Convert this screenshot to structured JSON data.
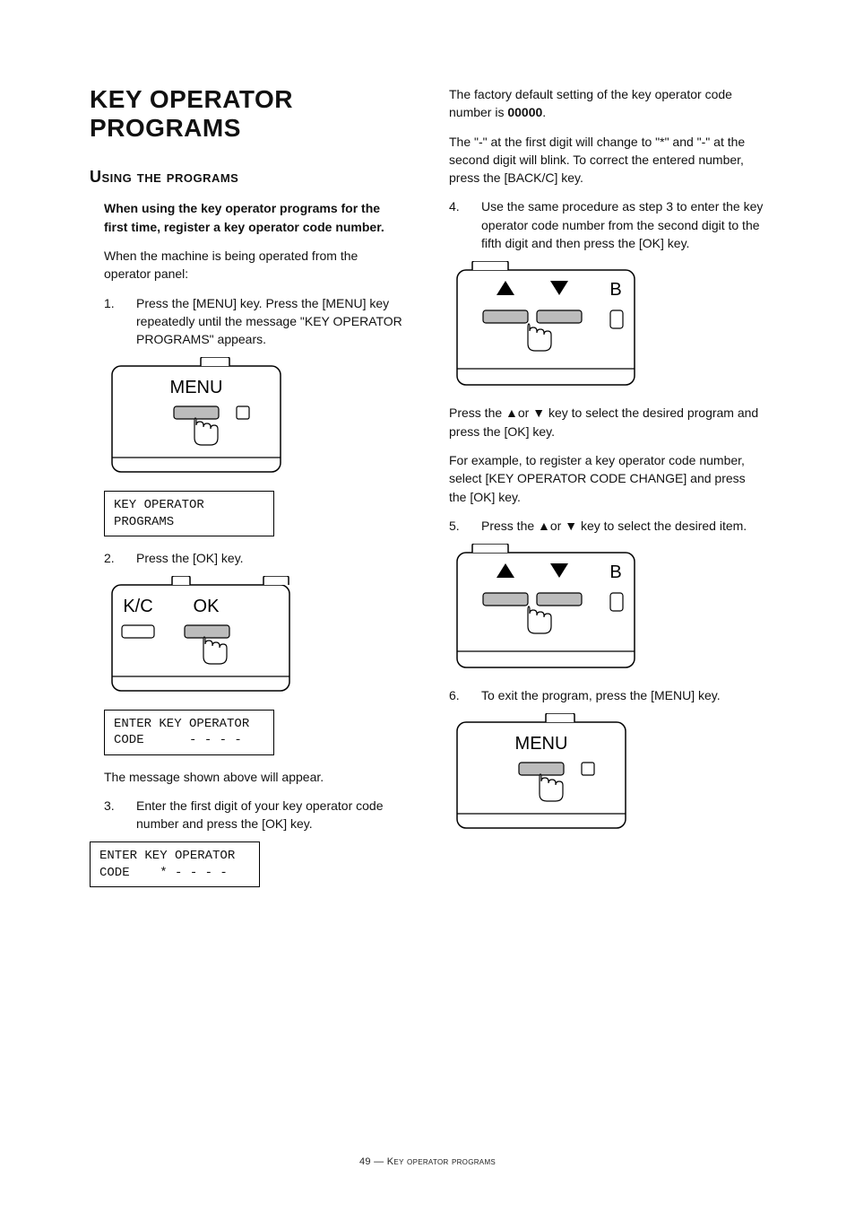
{
  "title": "KEY OPERATOR PROGRAMS",
  "subtitle": "Using the programs",
  "left": {
    "lead_bold": "When using the key operator programs for the first time, register a key operator code number.",
    "lead2": "When the machine is being operated from the operator panel:",
    "step1_num": "1.",
    "step1": "Press the [MENU] key. Press the [MENU] key repeatedly until the message \"KEY OPERATOR PROGRAMS\" appears.",
    "menu_label": "MENU",
    "lcd1_line1": "KEY OPERATOR",
    "lcd1_line2": "PROGRAMS",
    "step2_num": "2.",
    "step2": "Press the [OK] key.",
    "kc_label": "K/C",
    "ok_label": "OK",
    "lcd2_line1": "ENTER KEY OPERATOR",
    "lcd2_line2": "CODE      - - - -",
    "after_lcd2": "The message shown above will appear.",
    "step3_num": "3.",
    "step3": "Enter the first digit of your key operator code number and press the [OK] key.",
    "lcd3_line1": "ENTER KEY OPERATOR",
    "lcd3_line2": "CODE    * - - - -"
  },
  "right": {
    "factory_pre": "The factory default setting of the key operator code number is ",
    "factory_code": "00000",
    "factory_post": ".",
    "dash_note": "The \"-\" at the first digit will change to \"*\" and \"-\" at the second digit will blink. To correct the entered number, press the [BACK/C] key.",
    "step4_num": "4.",
    "step4": "Use the same procedure as step 3 to enter the key operator code number from the second digit to the fifth digit and then press the [OK] key.",
    "press_arrow1": "Press the ▲or ▼ key to select the desired program and press the [OK] key.",
    "example": "For example, to register a key operator code number, select [KEY OPERATOR CODE CHANGE] and press the [OK] key.",
    "step5_num": "5.",
    "step5": "Press the ▲or ▼ key to select the desired item.",
    "step6_num": "6.",
    "step6": "To exit the program, press the [MENU] key.",
    "menu_label": "MENU",
    "b_label": "B"
  },
  "footer": {
    "page": "49",
    "sep": " — ",
    "section": "Key operator programs"
  }
}
